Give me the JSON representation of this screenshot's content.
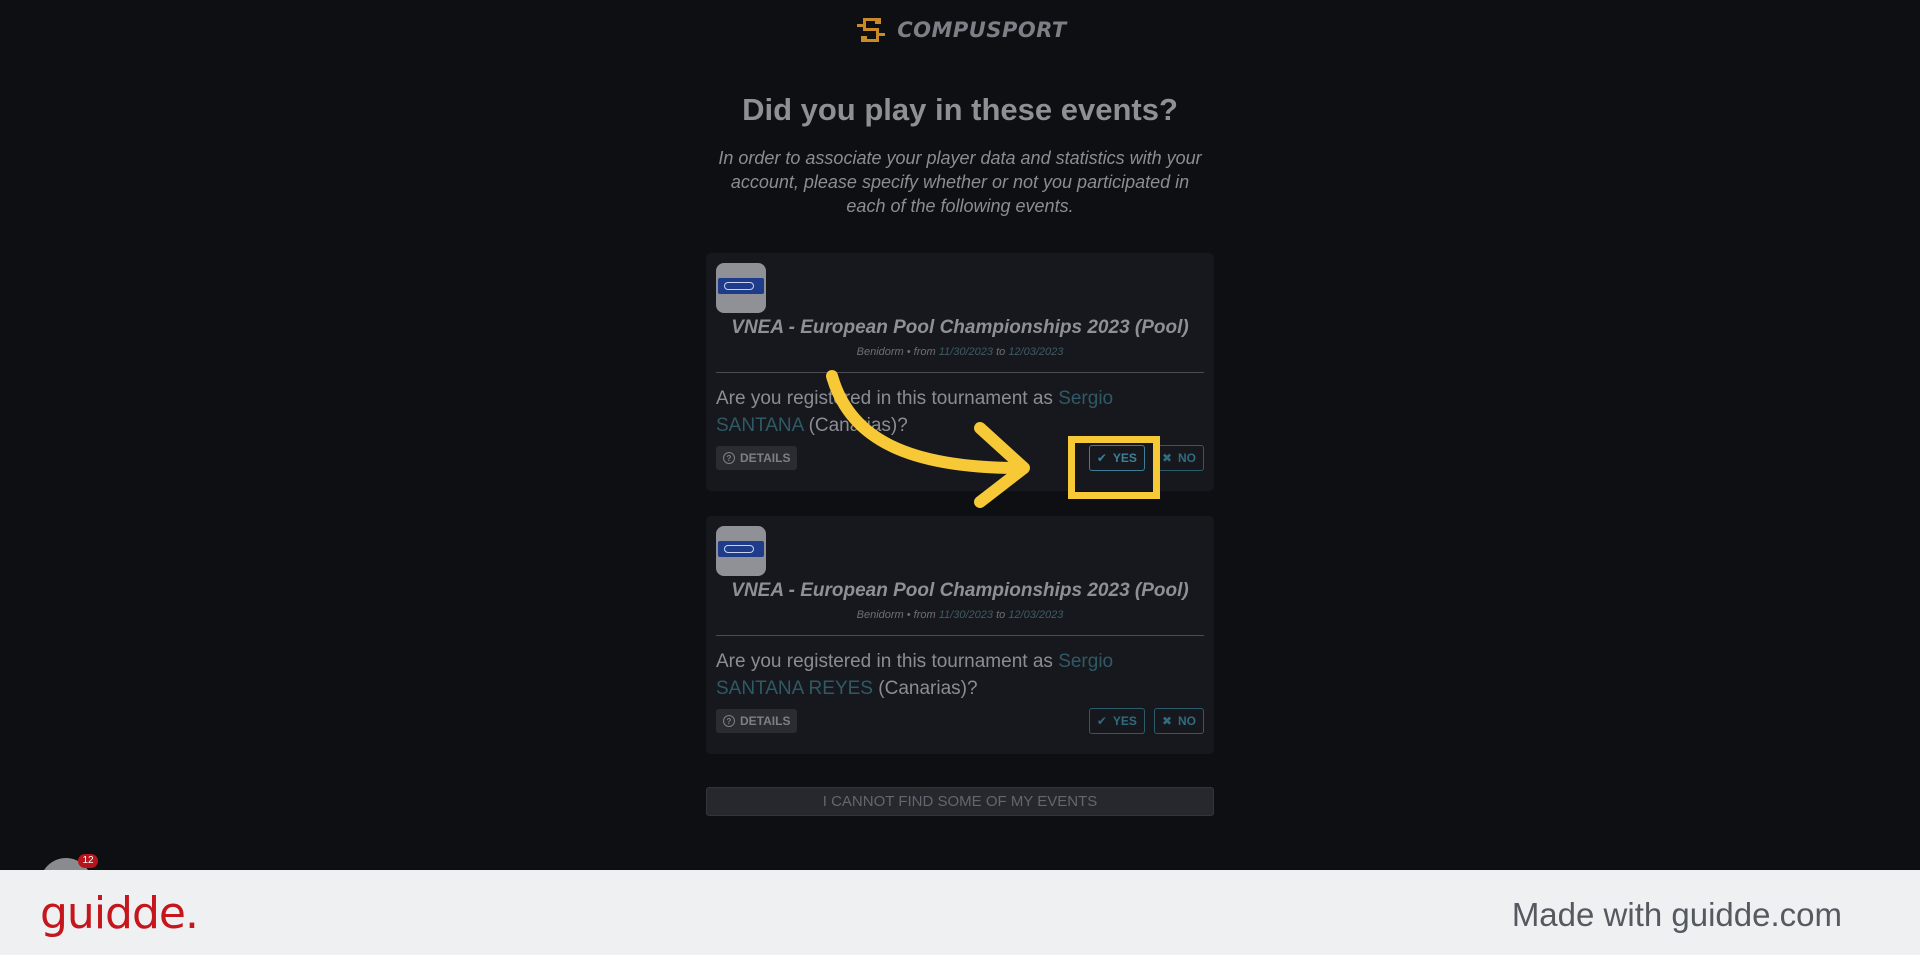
{
  "header": {
    "logo_text": "COMPUSPORT",
    "logo_icon": "compusport-logo-icon"
  },
  "main": {
    "title": "Did you play in these events?",
    "intro": "In order to associate your player data and statistics with your account, please specify whether or not you participated in each of the following events."
  },
  "events": [
    {
      "name": "VNEA - European Pool Championships 2023 (Pool)",
      "location": "Benidorm",
      "from_label": "• from",
      "from": "11/30/2023",
      "to_label": "to",
      "to": "12/03/2023",
      "question_prefix": "Are you registered in this tournament as",
      "player": "Sergio SANTANA",
      "question_suffix": "(Canarias)?",
      "details_label": "DETAILS",
      "yes_label": "YES",
      "no_label": "NO"
    },
    {
      "name": "VNEA - European Pool Championships 2023 (Pool)",
      "location": "Benidorm",
      "from_label": "• from",
      "from": "11/30/2023",
      "to_label": "to",
      "to": "12/03/2023",
      "question_prefix": "Are you registered in this tournament as",
      "player": "Sergio SANTANA REYES",
      "question_suffix": "(Canarias)?",
      "details_label": "DETAILS",
      "yes_label": "YES",
      "no_label": "NO"
    }
  ],
  "cannot_find_label": "I CANNOT FIND SOME OF MY EVENTS",
  "notification": {
    "count": "12"
  },
  "footer": {
    "brand": "guidde.",
    "made_with": "Made with guidde.com"
  },
  "colors": {
    "accent": "#2f6c80",
    "highlight": "#f7c937",
    "brand": "#c4161c",
    "logo": "#c98a2a"
  }
}
